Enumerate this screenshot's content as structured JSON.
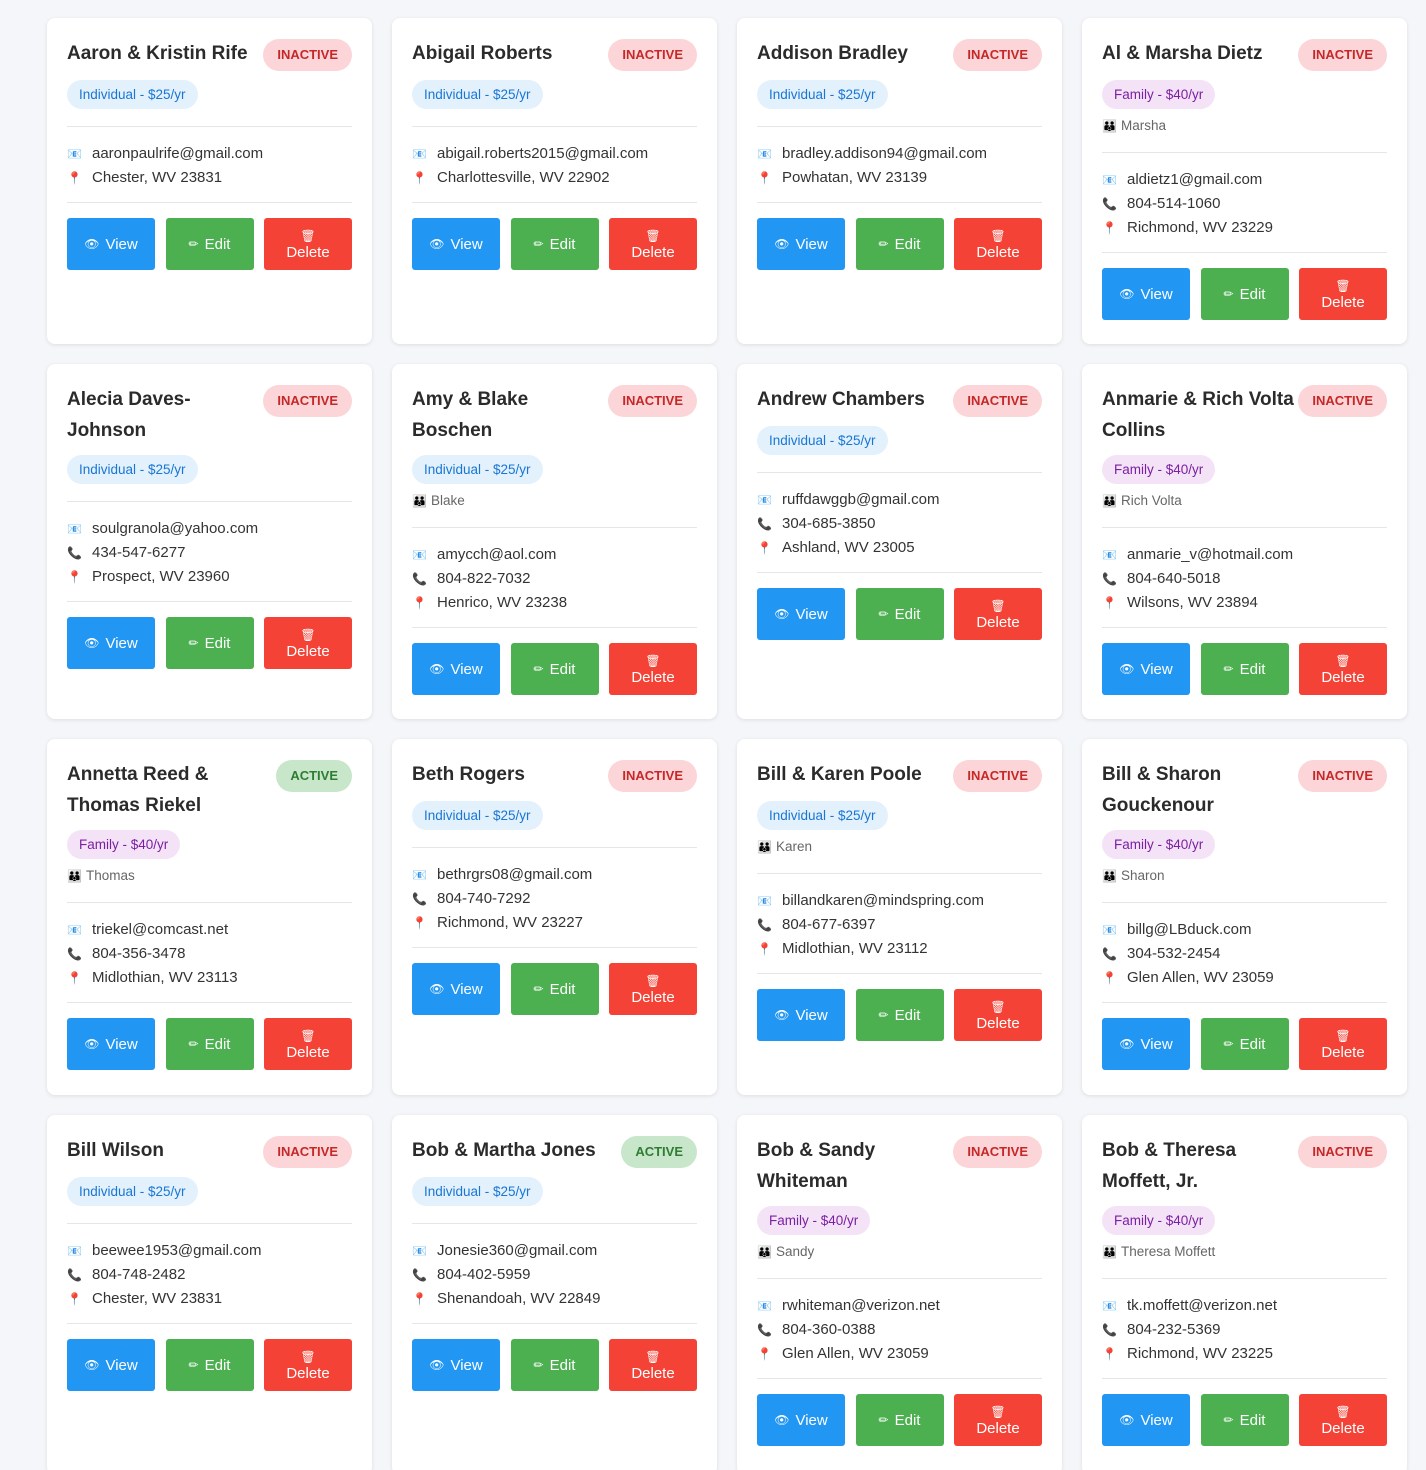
{
  "common": {
    "view_label": "View",
    "edit_label": "Edit",
    "delete_label": "Delete",
    "view_icon": "👁",
    "edit_icon": "✏",
    "delete_icon": "🗑",
    "email_icon": "📧",
    "phone_icon": "📞",
    "location_icon": "📍",
    "member_icon": "👪"
  },
  "members": [
    {
      "name": "Aaron & Kristin Rife",
      "status": "INACTIVE",
      "plan": "Individual - $25/yr",
      "email": "aaronpaulrife@gmail.com",
      "location": "Chester, WV 23831"
    },
    {
      "name": "Abigail Roberts",
      "status": "INACTIVE",
      "plan": "Individual - $25/yr",
      "email": "abigail.roberts2015@gmail.com",
      "location": "Charlottesville, WV 22902"
    },
    {
      "name": "Addison Bradley",
      "status": "INACTIVE",
      "plan": "Individual - $25/yr",
      "email": "bradley.addison94@gmail.com",
      "location": "Powhatan, WV 23139"
    },
    {
      "name": "Al & Marsha Dietz",
      "status": "INACTIVE",
      "plan": "Family - $40/yr",
      "member": "Marsha",
      "email": "aldietz1@gmail.com",
      "phone": "804-514-1060",
      "location": "Richmond, WV 23229"
    },
    {
      "name": "Alecia Daves-Johnson",
      "status": "INACTIVE",
      "plan": "Individual - $25/yr",
      "email": "soulgranola@yahoo.com",
      "phone": "434-547-6277",
      "location": "Prospect, WV 23960"
    },
    {
      "name": "Amy & Blake Boschen",
      "status": "INACTIVE",
      "plan": "Individual - $25/yr",
      "member": "Blake",
      "email": "amycch@aol.com",
      "phone": "804-822-7032",
      "location": "Henrico, WV 23238"
    },
    {
      "name": "Andrew Chambers",
      "status": "INACTIVE",
      "plan": "Individual - $25/yr",
      "email": "ruffdawggb@gmail.com",
      "phone": "304-685-3850",
      "location": "Ashland, WV 23005"
    },
    {
      "name": "Anmarie & Rich Volta Collins",
      "status": "INACTIVE",
      "plan": "Family - $40/yr",
      "member": "Rich Volta",
      "email": "anmarie_v@hotmail.com",
      "phone": "804-640-5018",
      "location": "Wilsons, WV 23894"
    },
    {
      "name": "Annetta Reed & Thomas Riekel",
      "status": "ACTIVE",
      "plan": "Family - $40/yr",
      "member": "Thomas",
      "email": "triekel@comcast.net",
      "phone": "804-356-3478",
      "location": "Midlothian, WV 23113"
    },
    {
      "name": "Beth Rogers",
      "status": "INACTIVE",
      "plan": "Individual - $25/yr",
      "email": "bethrgrs08@gmail.com",
      "phone": "804-740-7292",
      "location": "Richmond, WV 23227"
    },
    {
      "name": "Bill & Karen Poole",
      "status": "INACTIVE",
      "plan": "Individual - $25/yr",
      "member": "Karen",
      "email": "billandkaren@mindspring.com",
      "phone": "804-677-6397",
      "location": "Midlothian, WV 23112"
    },
    {
      "name": "Bill & Sharon Gouckenour",
      "status": "INACTIVE",
      "plan": "Family - $40/yr",
      "member": "Sharon",
      "email": "billg@LBduck.com",
      "phone": "304-532-2454",
      "location": "Glen Allen, WV 23059"
    },
    {
      "name": "Bill Wilson",
      "status": "INACTIVE",
      "plan": "Individual - $25/yr",
      "email": "beewee1953@gmail.com",
      "phone": "804-748-2482",
      "location": "Chester, WV 23831"
    },
    {
      "name": "Bob & Martha Jones",
      "status": "ACTIVE",
      "plan": "Individual - $25/yr",
      "email": "Jonesie360@gmail.com",
      "phone": "804-402-5959",
      "location": "Shenandoah, WV 22849"
    },
    {
      "name": "Bob & Sandy Whiteman",
      "status": "INACTIVE",
      "plan": "Family - $40/yr",
      "member": "Sandy",
      "email": "rwhiteman@verizon.net",
      "phone": "804-360-0388",
      "location": "Glen Allen, WV 23059"
    },
    {
      "name": "Bob & Theresa Moffett, Jr.",
      "status": "INACTIVE",
      "plan": "Family - $40/yr",
      "member": "Theresa Moffett",
      "email": "tk.moffett@verizon.net",
      "phone": "804-232-5369",
      "location": "Richmond, WV 23225"
    }
  ]
}
